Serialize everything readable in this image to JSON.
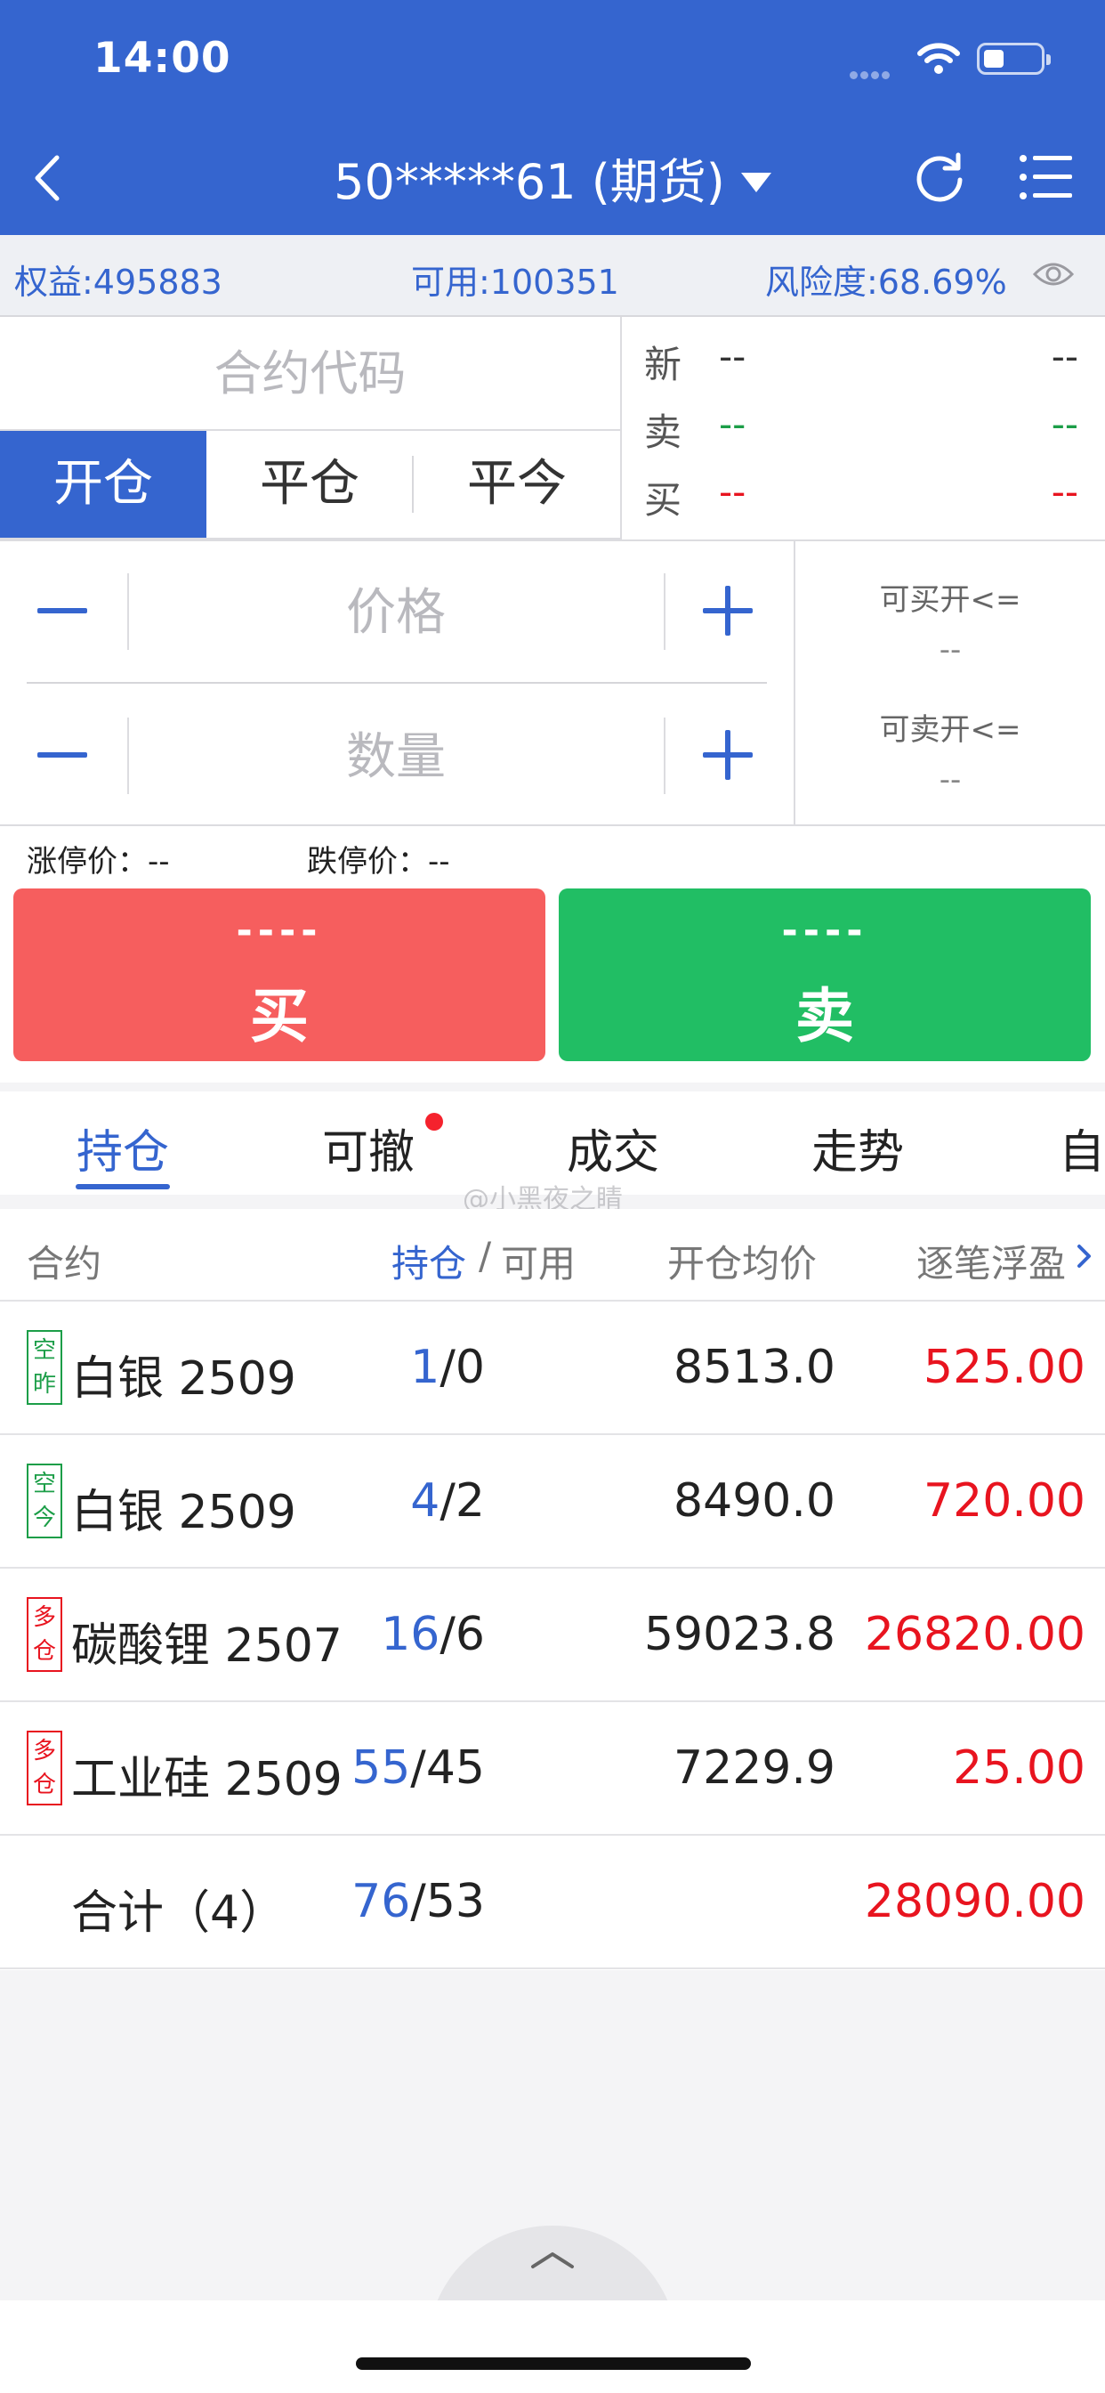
{
  "status_bar": {
    "time": "14:00"
  },
  "header": {
    "account": "50*****61 (期货)"
  },
  "summary": {
    "equity": "权益:495883",
    "available": "可用:100351",
    "risk": "风险度:68.69%"
  },
  "order": {
    "code_placeholder": "合约代码",
    "tabs": [
      "开仓",
      "平仓",
      "平今"
    ],
    "quote": [
      {
        "label": "新",
        "v1": "--",
        "v2": "--"
      },
      {
        "label": "卖",
        "v1": "--",
        "v2": "--"
      },
      {
        "label": "买",
        "v1": "--",
        "v2": "--"
      }
    ],
    "quote_colors": {
      "neutral": "#333333",
      "sell": "#1c9e48",
      "buy": "#e8141f"
    },
    "price_placeholder": "价格",
    "qty_placeholder": "数量",
    "can_buy_label": "可买开<=",
    "can_buy_value": "--",
    "can_sell_label": "可卖开<=",
    "can_sell_value": "--",
    "limit_up": "涨停价：--",
    "limit_down": "跌停价：--",
    "buy": {
      "price": "----",
      "label": "买",
      "color": "#f65e5e"
    },
    "sell": {
      "price": "----",
      "label": "卖",
      "color": "#21be64"
    }
  },
  "bottom_tabs": [
    "持仓",
    "可撤",
    "成交",
    "走势",
    "自"
  ],
  "watermark": "@小黑夜之睛",
  "positions": {
    "headers": {
      "contract": "合约",
      "hold": "持仓",
      "sep": "/",
      "avail": "可用",
      "avg": "开仓均价",
      "pl": "逐笔浮盈"
    },
    "rows": [
      {
        "badge": [
          "空",
          "昨"
        ],
        "badge_color": "green",
        "name": "白银 2509",
        "hold": "1",
        "avail": "0",
        "avg": "8513.0",
        "pl": "525.00"
      },
      {
        "badge": [
          "空",
          "今"
        ],
        "badge_color": "green",
        "name": "白银 2509",
        "hold": "4",
        "avail": "2",
        "avg": "8490.0",
        "pl": "720.00"
      },
      {
        "badge": [
          "多",
          "仓"
        ],
        "badge_color": "red",
        "name": "碳酸锂 2507",
        "hold": "16",
        "avail": "6",
        "avg": "59023.8",
        "pl": "26820.00"
      },
      {
        "badge": [
          "多",
          "仓"
        ],
        "badge_color": "red",
        "name": "工业硅 2509",
        "hold": "55",
        "avail": "45",
        "avg": "7229.9",
        "pl": "25.00"
      }
    ],
    "total": {
      "label": "合计（4）",
      "hold": "76",
      "avail": "53",
      "pl": "28090.00"
    }
  },
  "colors": {
    "brand": "#3565cf",
    "profit": "#e8141f",
    "long": "#e8141f",
    "short": "#1c9e48"
  }
}
